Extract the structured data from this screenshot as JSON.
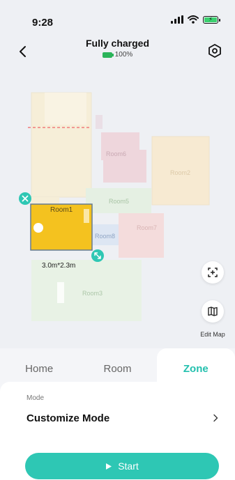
{
  "status_bar": {
    "time": "9:28"
  },
  "header": {
    "title": "Fully charged",
    "battery_level": "100%"
  },
  "map": {
    "rooms": [
      "Room6",
      "Room2",
      "Room5",
      "Room1",
      "Room8",
      "Room7",
      "Room3"
    ],
    "selected_room": "Room1",
    "zone_size": "3.0m*2.3m"
  },
  "side_actions": {
    "edit_map_label": "Edit Map"
  },
  "tabs": [
    {
      "label": "Home",
      "active": false
    },
    {
      "label": "Room",
      "active": false
    },
    {
      "label": "Zone",
      "active": true
    }
  ],
  "panel": {
    "mode_label": "Mode",
    "mode_value": "Customize Mode"
  },
  "start_label": "Start",
  "colors": {
    "accent": "#2ec7b4",
    "zone_fill": "#f4c21f",
    "battery": "#2bb45a"
  }
}
